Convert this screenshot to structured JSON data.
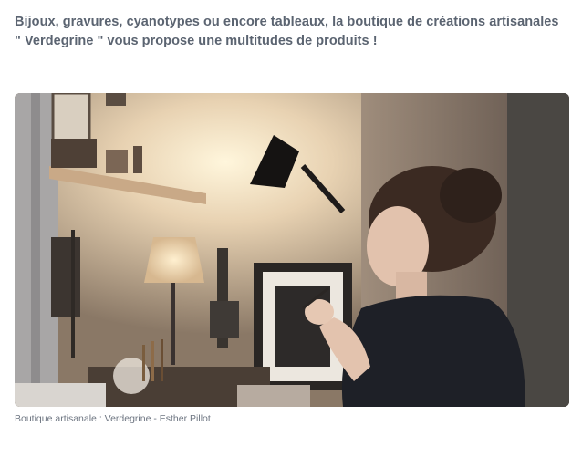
{
  "article": {
    "lead_line1": "Bijoux, gravures, cyanotypes ou encore tableaux, la boutique de créations artisanales",
    "lead_line2": "\" Verdegrine \" vous propose une multitudes de produits !"
  },
  "photo": {
    "caption": "Boutique artisanale : Verdegrine - Esther Pillot"
  }
}
